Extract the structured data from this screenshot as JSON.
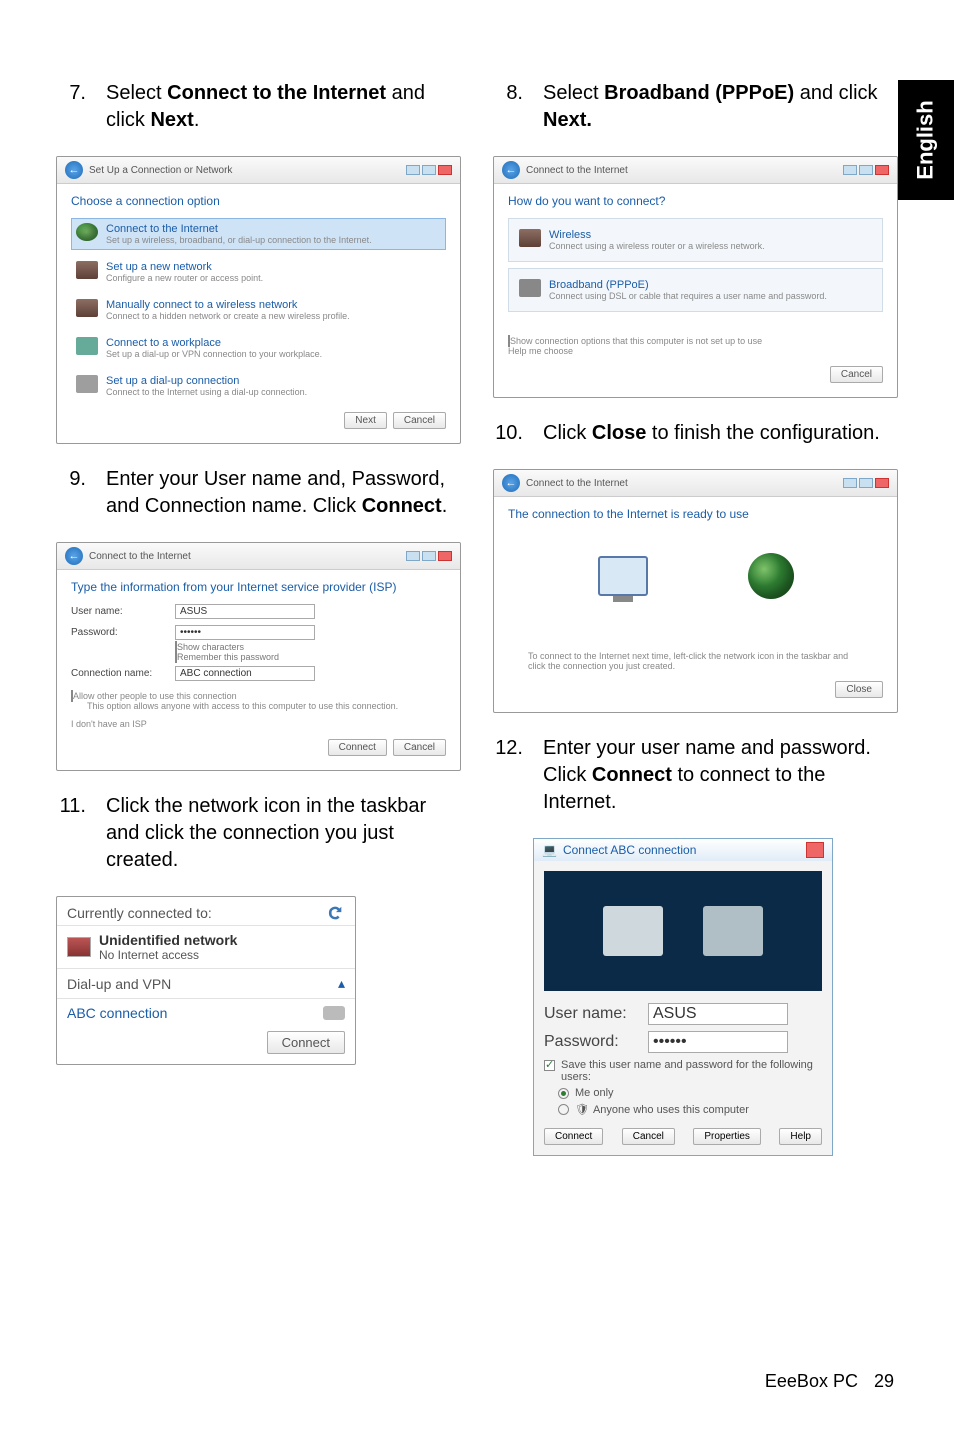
{
  "side_tab": "English",
  "steps": {
    "s7": {
      "num": "7.",
      "pre": "Select ",
      "bold1": "Connect to the Internet",
      "mid": " and click ",
      "bold2": "Next",
      "post": "."
    },
    "s8": {
      "num": "8.",
      "pre": "Select ",
      "bold1": "Broadband (PPPoE)",
      "mid": " and click ",
      "bold2": "Next.",
      "post": ""
    },
    "s9": {
      "num": "9.",
      "text_a": "Enter your User name and, Password, and Connection name. Click ",
      "bold": "Connect",
      "text_b": "."
    },
    "s10": {
      "num": "10.",
      "text_a": "Click ",
      "bold": "Close",
      "text_b": " to finish the configuration."
    },
    "s11": {
      "num": "11.",
      "text": "Click the network icon in the taskbar and click the connection you just created."
    },
    "s12": {
      "num": "12.",
      "text_a": "Enter your user name and password. Click ",
      "bold": "Connect",
      "text_b": " to connect to the Internet."
    }
  },
  "win7": {
    "title": "Set Up a Connection or Network",
    "head": "Choose a connection option",
    "opts": [
      {
        "t": "Connect to the Internet",
        "s": "Set up a wireless, broadband, or dial-up connection to the Internet."
      },
      {
        "t": "Set up a new network",
        "s": "Configure a new router or access point."
      },
      {
        "t": "Manually connect to a wireless network",
        "s": "Connect to a hidden network or create a new wireless profile."
      },
      {
        "t": "Connect to a workplace",
        "s": "Set up a dial-up or VPN connection to your workplace."
      },
      {
        "t": "Set up a dial-up connection",
        "s": "Connect to the Internet using a dial-up connection."
      }
    ],
    "next": "Next",
    "cancel": "Cancel"
  },
  "win8": {
    "title": "Connect to the Internet",
    "head": "How do you want to connect?",
    "opts": [
      {
        "t": "Wireless",
        "s": "Connect using a wireless router or a wireless network."
      },
      {
        "t": "Broadband (PPPoE)",
        "s": "Connect using DSL or cable that requires a user name and password."
      }
    ],
    "show": "Show connection options that this computer is not set up to use",
    "help": "Help me choose",
    "cancel": "Cancel"
  },
  "win9": {
    "title": "Connect to the Internet",
    "head": "Type the information from your Internet service provider (ISP)",
    "user_lbl": "User name:",
    "user_val": "ASUS",
    "pass_lbl": "Password:",
    "pass_val": "••••••",
    "show_chars": "Show characters",
    "remember": "Remember this password",
    "conn_lbl": "Connection name:",
    "conn_val": "ABC connection",
    "allow": "Allow other people to use this connection",
    "allow_sub": "This option allows anyone with access to this computer to use this connection.",
    "noisp": "I don't have an ISP",
    "connect": "Connect",
    "cancel": "Cancel"
  },
  "win10": {
    "title": "Connect to the Internet",
    "head": "The connection to the Internet is ready to use",
    "tip": "To connect to the Internet next time, left-click the network icon in the taskbar and click the connection you just created.",
    "close": "Close"
  },
  "flyout": {
    "head": "Currently connected to:",
    "net_name": "Unidentified network",
    "net_sub": "No Internet access",
    "section": "Dial-up and VPN",
    "conn": "ABC connection",
    "connect": "Connect"
  },
  "dlg12": {
    "title": "Connect ABC connection",
    "user_lbl": "User name:",
    "user_val": "ASUS",
    "pass_lbl": "Password:",
    "pass_val": "••••••",
    "save": "Save this user name and password for the following users:",
    "me": "Me only",
    "anyone": "Anyone who uses this computer",
    "connect": "Connect",
    "cancel": "Cancel",
    "props": "Properties",
    "help": "Help"
  },
  "footer": {
    "product": "EeeBox PC",
    "page": "29"
  }
}
